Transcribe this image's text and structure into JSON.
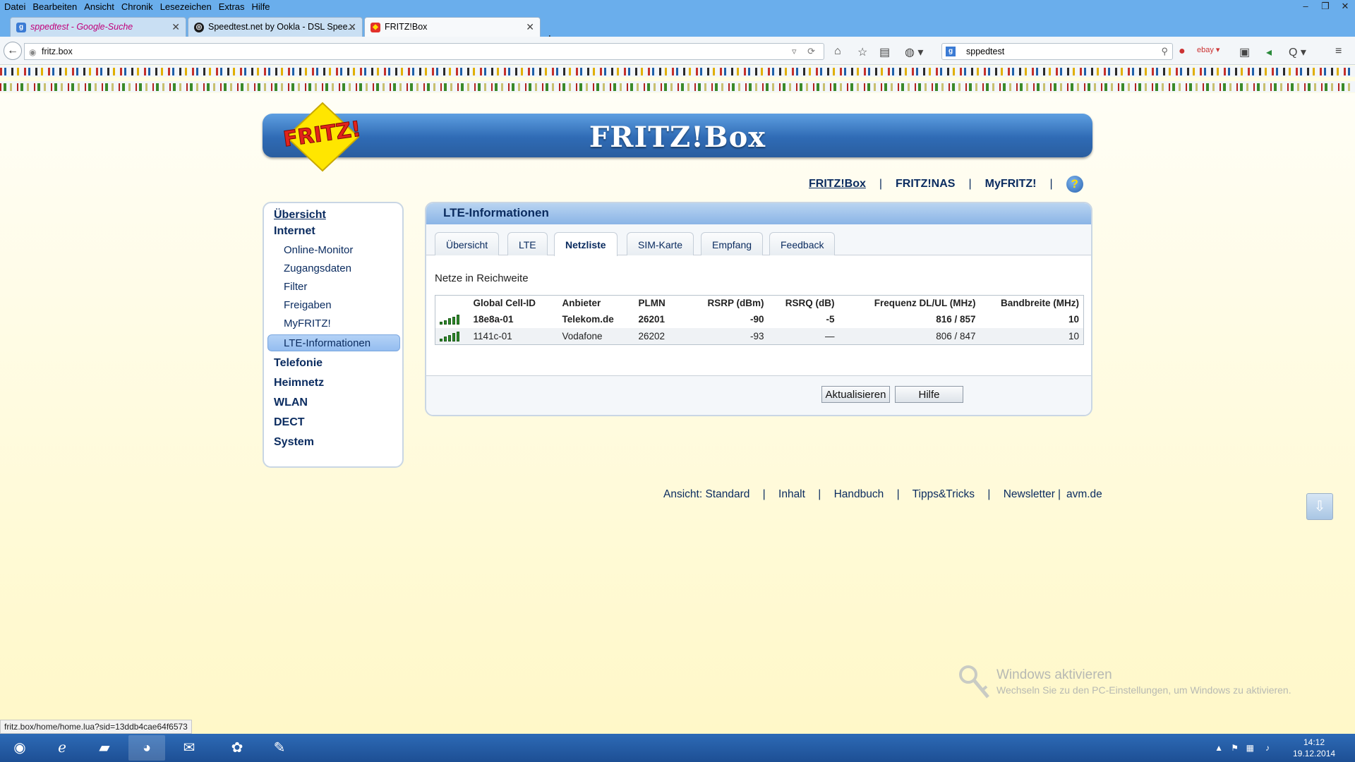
{
  "menubar": [
    "Datei",
    "Bearbeiten",
    "Ansicht",
    "Chronik",
    "Lesezeichen",
    "Extras",
    "Hilfe"
  ],
  "tabs": [
    {
      "title": "sppedtest - Google-Suche",
      "icon": "google-icon"
    },
    {
      "title": "Speedtest.net by Ookla - DSL Spee...",
      "icon": "speedtest-icon"
    },
    {
      "title": "FRITZ!Box",
      "icon": "fritz-icon"
    }
  ],
  "url": "fritz.box",
  "search": {
    "value": "sppedtest",
    "engine_badge": "g"
  },
  "colors": {
    "accent": "#2f6bb5",
    "nav_text": "#0b2c60",
    "page_bg": "#fffde2"
  },
  "banner": {
    "logo": "FRITZ!",
    "title": "FRITZ!Box"
  },
  "topnav": {
    "fritzbox": "FRITZ!Box",
    "fritznas": "FRITZ!NAS",
    "myfritz": "MyFRITZ!",
    "sep": "|",
    "help": "?"
  },
  "sidebar": {
    "uebersicht": "Übersicht",
    "internet": "Internet",
    "sub": [
      "Online-Monitor",
      "Zugangsdaten",
      "Filter",
      "Freigaben",
      "MyFRITZ!",
      "LTE-Informationen"
    ],
    "telefonie": "Telefonie",
    "heimnetz": "Heimnetz",
    "wlan": "WLAN",
    "dect": "DECT",
    "system": "System"
  },
  "panel": {
    "title": "LTE-Informationen",
    "tabs": [
      "Übersicht",
      "LTE",
      "Netzliste",
      "SIM-Karte",
      "Empfang",
      "Feedback"
    ],
    "active_tab": "Netzliste",
    "subtitle": "Netze in Reichweite",
    "table": {
      "headers": [
        "",
        "Global Cell-ID",
        "Anbieter",
        "PLMN",
        "RSRP (dBm)",
        "RSRQ (dB)",
        "Frequenz DL/UL (MHz)",
        "Bandbreite (MHz)"
      ],
      "rows": [
        {
          "signal": 5,
          "cell": "18e8a-01",
          "provider": "Telekom.de",
          "plmn": "26201",
          "rsrp": "-90",
          "rsrq": "-5",
          "freq": "816 / 857",
          "bw": "10"
        },
        {
          "signal": 5,
          "cell": "1141c-01",
          "provider": "Vodafone",
          "plmn": "26202",
          "rsrp": "-93",
          "rsrq": "—",
          "freq": "806 / 847",
          "bw": "10"
        }
      ]
    },
    "buttons": {
      "refresh": "Aktualisieren",
      "help": "Hilfe"
    }
  },
  "footer": {
    "view_label": "Ansicht: Standard",
    "links": [
      "Inhalt",
      "Handbuch",
      "Tipps&Tricks",
      "Newsletter",
      "avm.de"
    ],
    "sep": "|"
  },
  "activation": {
    "title": "Windows aktivieren",
    "text": "Wechseln Sie zu den PC-Einstellungen, um Windows zu aktivieren."
  },
  "status_url": "fritz.box/home/home.lua?sid=13ddb4cae64f6573",
  "clock": {
    "time": "14:12",
    "date": "19.12.2014"
  }
}
